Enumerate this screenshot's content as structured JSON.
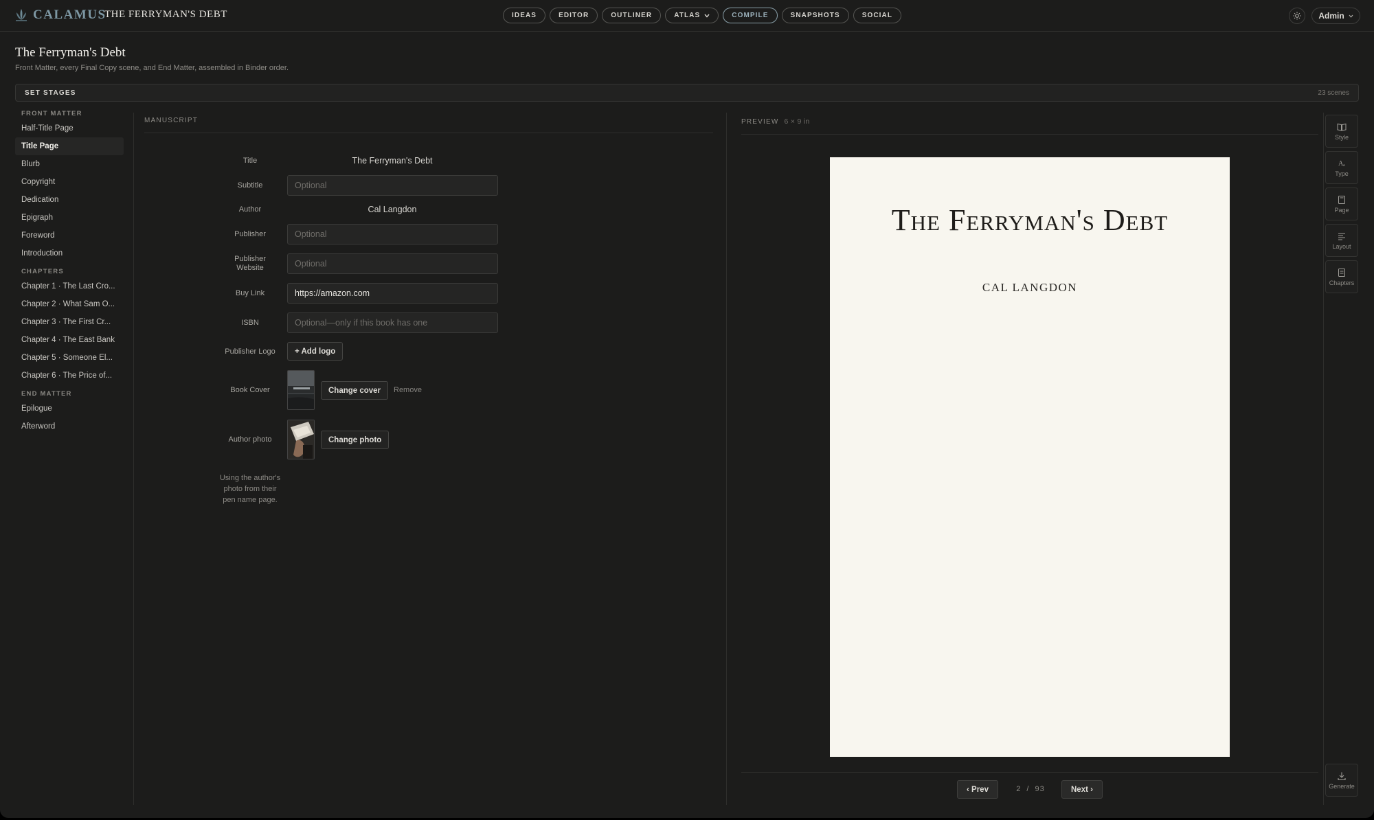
{
  "app": {
    "brand": "CALAMUS",
    "project_name": "THE FERRYMAN'S DEBT",
    "brand_color": "#7d97a3"
  },
  "nav": {
    "items": [
      {
        "label": "IDEAS"
      },
      {
        "label": "EDITOR"
      },
      {
        "label": "OUTLINER"
      },
      {
        "label": "ATLAS"
      },
      {
        "label": "COMPILE"
      },
      {
        "label": "SNAPSHOTS"
      },
      {
        "label": "SOCIAL"
      }
    ],
    "active": "COMPILE",
    "atlas_chevron": "⌄"
  },
  "user": {
    "label": "Admin",
    "icon": "chevron-down-icon",
    "theme_icon": "sun-icon"
  },
  "page": {
    "title": "The Ferryman's Debt",
    "subtitle": "Front Matter, every Final Copy scene, and End Matter, assembled in Binder order."
  },
  "stages": {
    "label": "SET STAGES",
    "count": "23 scenes"
  },
  "binder": {
    "front_label": "FRONT MATTER",
    "front": [
      "Half-Title Page",
      "Title Page",
      "Blurb",
      "Copyright",
      "Dedication",
      "Epigraph",
      "Foreword",
      "Introduction"
    ],
    "selected": "Title Page",
    "chapters_label": "CHAPTERS",
    "chapters": [
      "Chapter 1 · The Last Cro...",
      "Chapter 2 · What Sam O...",
      "Chapter 3 · The First Cr...",
      "Chapter 4 · The East Bank",
      "Chapter 5 · Someone El...",
      "Chapter 6 · The Price of..."
    ],
    "end_label": "END MATTER",
    "end": [
      "Epilogue",
      "Afterword"
    ]
  },
  "manuscript": {
    "header": "MANUSCRIPT",
    "labels": {
      "title": "Title",
      "subtitle": "Subtitle",
      "author": "Author",
      "publisher": "Publisher",
      "publisher_website": "Publisher Website",
      "buy_link": "Buy Link",
      "isbn": "ISBN",
      "publisher_logo": "Publisher Logo",
      "book_cover": "Book Cover",
      "author_photo": "Author photo"
    },
    "values": {
      "title": "The Ferryman's Debt",
      "author": "Cal Langdon",
      "subtitle": "",
      "publisher": "",
      "publisher_website": "",
      "buy_link": "https://amazon.com",
      "isbn": ""
    },
    "placeholders": {
      "subtitle": "Optional",
      "publisher": "Optional",
      "publisher_website": "Optional",
      "isbn": "Optional—only if this book has one"
    },
    "buttons": {
      "add_logo": "+ Add logo",
      "change_cover": "Change cover",
      "remove": "Remove",
      "change_photo": "Change photo"
    },
    "photo_note": "Using the author's photo from their pen name page."
  },
  "preview": {
    "header": "PREVIEW",
    "size": "6 × 9 in",
    "page_title": "The Ferryman's Debt",
    "page_author": "CAL LANGDON",
    "current_page": "2",
    "separator": "/",
    "total_pages": "93",
    "prev": "‹ Prev",
    "next": "Next ›"
  },
  "tools": [
    {
      "label": "Style",
      "icon": "book-icon"
    },
    {
      "label": "Type",
      "icon": "type-icon"
    },
    {
      "label": "Page",
      "icon": "page-icon"
    },
    {
      "label": "Layout",
      "icon": "layout-icon"
    },
    {
      "label": "Chapters",
      "icon": "chapters-icon"
    }
  ],
  "generate": {
    "label": "Generate",
    "icon": "download-icon"
  }
}
